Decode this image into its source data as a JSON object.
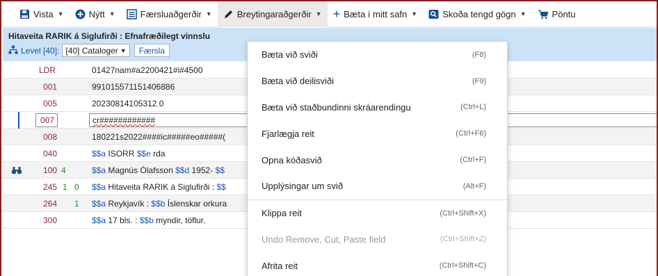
{
  "toolbar": {
    "items": [
      {
        "label": "Vista",
        "icon": "save-icon"
      },
      {
        "label": "Nýtt",
        "icon": "plus-circle-icon"
      },
      {
        "label": "Færsluaðgerðir",
        "icon": "record-icon"
      },
      {
        "label": "Breytingaraðgerðir",
        "icon": "pencil-icon"
      },
      {
        "label": "Bæta í mitt safn",
        "icon": "plus-icon"
      },
      {
        "label": "Skoða tengd gögn",
        "icon": "search-icon"
      },
      {
        "label": "Pöntu",
        "icon": "cart-icon"
      }
    ]
  },
  "record": {
    "title": "Hitaveita RARIK á Siglufirði : Efnafræðilegt vinnslu",
    "level_label": "Level [40]:",
    "level_value": "[40] Cataloger",
    "record_button": "Færsla"
  },
  "fields": [
    {
      "tag": "LDR",
      "ind1": "",
      "ind2": "",
      "value": "01427nam#a2200421#i#4500"
    },
    {
      "tag": "001",
      "ind1": "",
      "ind2": "",
      "value": "991015571151406886"
    },
    {
      "tag": "005",
      "ind1": "",
      "ind2": "",
      "value": "20230814105312.0"
    },
    {
      "tag": "007",
      "ind1": "",
      "ind2": "",
      "value": "cr############"
    },
    {
      "tag": "008",
      "ind1": "",
      "ind2": "",
      "value": "180221s2022####ic#####eo#####("
    },
    {
      "tag": "040",
      "ind1": "",
      "ind2": "",
      "sf": [
        [
          "$$a",
          "ISORR"
        ],
        [
          "$$e",
          "rda"
        ]
      ]
    },
    {
      "tag": "100",
      "ind1": "4",
      "ind2": "",
      "sf": [
        [
          "$$a",
          "Magnús Ólafsson"
        ],
        [
          "$$d",
          "1952-"
        ],
        [
          "$$",
          ""
        ]
      ]
    },
    {
      "tag": "245",
      "ind1": "1",
      "ind2": "0",
      "sf": [
        [
          "$$a",
          "Hitaveita RARIK á Siglufirði :"
        ],
        [
          "$$",
          ""
        ]
      ]
    },
    {
      "tag": "264",
      "ind1": "",
      "ind2": "1",
      "sf": [
        [
          "$$a",
          "Reykjavík :"
        ],
        [
          "$$b",
          "Íslenskar orkura"
        ]
      ]
    },
    {
      "tag": "300",
      "ind1": "",
      "ind2": "",
      "sf": [
        [
          "$$a",
          "17 bls. :"
        ],
        [
          "$$b",
          "myndir, töflur."
        ]
      ]
    }
  ],
  "menu": {
    "items": [
      {
        "label": "Bæta við sviði",
        "shortcut": "(F8)",
        "disabled": false
      },
      {
        "label": "Bæta við deilisviði",
        "shortcut": "(F9)",
        "disabled": false
      },
      {
        "label": "Bæta við staðbundinni skráarendingu",
        "shortcut": "(Ctrl+L)",
        "disabled": false
      },
      {
        "label": "Fjarlægja reit",
        "shortcut": "(Ctrl+F6)",
        "disabled": false
      },
      {
        "label": "Opna kóðasvið",
        "shortcut": "(Ctrl+F)",
        "disabled": false
      },
      {
        "label": "Upplýsingar um svið",
        "shortcut": "(Alt+F)",
        "disabled": false
      },
      {
        "label": "Klippa reit",
        "shortcut": "(Ctrl+Shift+X)",
        "disabled": false
      },
      {
        "label": "Undo Remove, Cut, Paste field",
        "shortcut": "(Ctrl+Shift+Z)",
        "disabled": true
      },
      {
        "label": "Afrita reit",
        "shortcut": "(Ctrl+Shift+C)",
        "disabled": false
      }
    ]
  },
  "colors": {
    "header_bg": "#cce3f7",
    "accent": "#1a56b5",
    "tag": "#8b2252",
    "indicator": "#228b22",
    "frame": "#8b1d1d"
  }
}
